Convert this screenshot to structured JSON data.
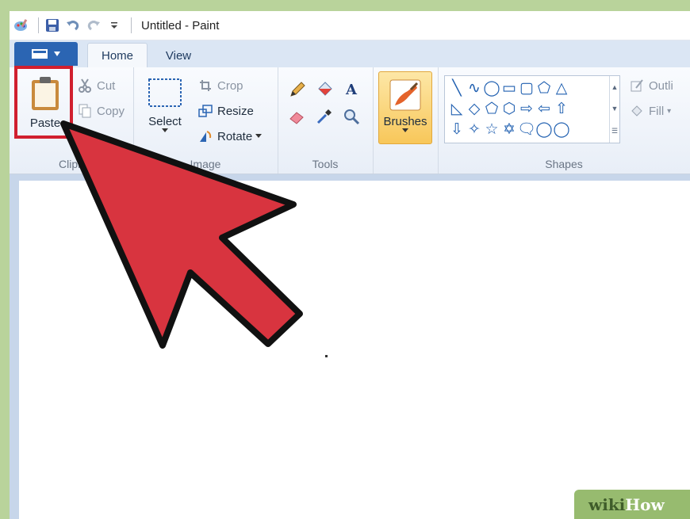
{
  "window": {
    "title": "Untitled - Paint"
  },
  "tabs": {
    "home": "Home",
    "view": "View"
  },
  "clipboard": {
    "paste": "Paste",
    "cut": "Cut",
    "copy": "Copy",
    "group_label": "Clipb"
  },
  "image": {
    "select": "Select",
    "crop": "Crop",
    "resize": "Resize",
    "rotate": "Rotate",
    "group_label": "Image"
  },
  "tools": {
    "group_label": "Tools"
  },
  "brushes": {
    "label": "Brushes"
  },
  "shapes": {
    "group_label": "Shapes",
    "outline": "Outli",
    "fill": "Fill",
    "items": [
      "╲",
      "∿",
      "◯",
      "▭",
      "▢",
      "⬠",
      "△",
      "",
      "",
      "◺",
      "◇",
      "⬠",
      "⬡",
      "⇨",
      "⇦",
      "⇧",
      "",
      "",
      "⇩",
      "✧",
      "☆",
      "✡",
      "🗨",
      "◯",
      "◯",
      "",
      ""
    ]
  },
  "watermark": {
    "wiki": "wiki",
    "how": "How"
  },
  "colors": {
    "accent_red": "#d01f2e",
    "ribbon_blue": "#2b65b3",
    "brush_orange": "#f8c75a"
  }
}
